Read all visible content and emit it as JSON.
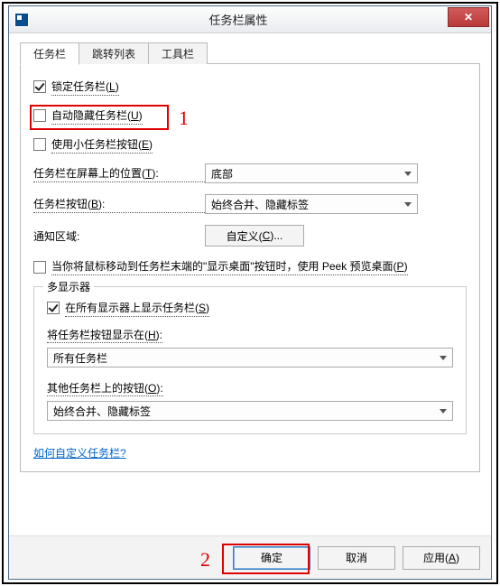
{
  "window": {
    "title": "任务栏属性",
    "close_tooltip": "关闭"
  },
  "tabs": [
    {
      "label": "任务栏",
      "active": true
    },
    {
      "label": "跳转列表",
      "active": false
    },
    {
      "label": "工具栏",
      "active": false
    }
  ],
  "taskbar": {
    "lock": {
      "label": "锁定任务栏(",
      "access": "L",
      "suffix": ")",
      "checked": true
    },
    "autohide": {
      "label": "自动隐藏任务栏(",
      "access": "U",
      "suffix": ")",
      "checked": false
    },
    "small_buttons": {
      "label": "使用小任务栏按钮(",
      "access": "E",
      "suffix": ")",
      "checked": false
    },
    "location": {
      "label": "任务栏在屏幕上的位置(",
      "access": "T",
      "suffix": "):",
      "value": "底部"
    },
    "buttons": {
      "label": "任务栏按钮(",
      "access": "B",
      "suffix": "):",
      "value": "始终合并、隐藏标签"
    },
    "notify": {
      "label": "通知区域:",
      "button": "自定义(",
      "button_access": "C",
      "button_suffix": ")..."
    },
    "peek": {
      "label_prefix": "当你将鼠标移动到任务栏末端的\"显示桌面\"按钮时，使用 Peek 预览桌面(",
      "access": "P",
      "suffix": ")",
      "checked": false
    }
  },
  "multi": {
    "legend": "多显示器",
    "show_all": {
      "label": "在所有显示器上显示任务栏(",
      "access": "S",
      "suffix": ")",
      "checked": true
    },
    "show_buttons_on": {
      "label": "将任务栏按钮显示在(",
      "access": "H",
      "suffix": "):",
      "value": "所有任务栏"
    },
    "other_buttons": {
      "label": "其他任务栏上的按钮(",
      "access": "O",
      "suffix": "):",
      "value": "始终合并、隐藏标签"
    }
  },
  "link": {
    "label": "如何自定义任务栏?"
  },
  "buttons": {
    "ok": "确定",
    "cancel": "取消",
    "apply": "应用(",
    "apply_access": "A",
    "apply_suffix": ")"
  },
  "annotations": {
    "n1": "1",
    "n2": "2"
  }
}
